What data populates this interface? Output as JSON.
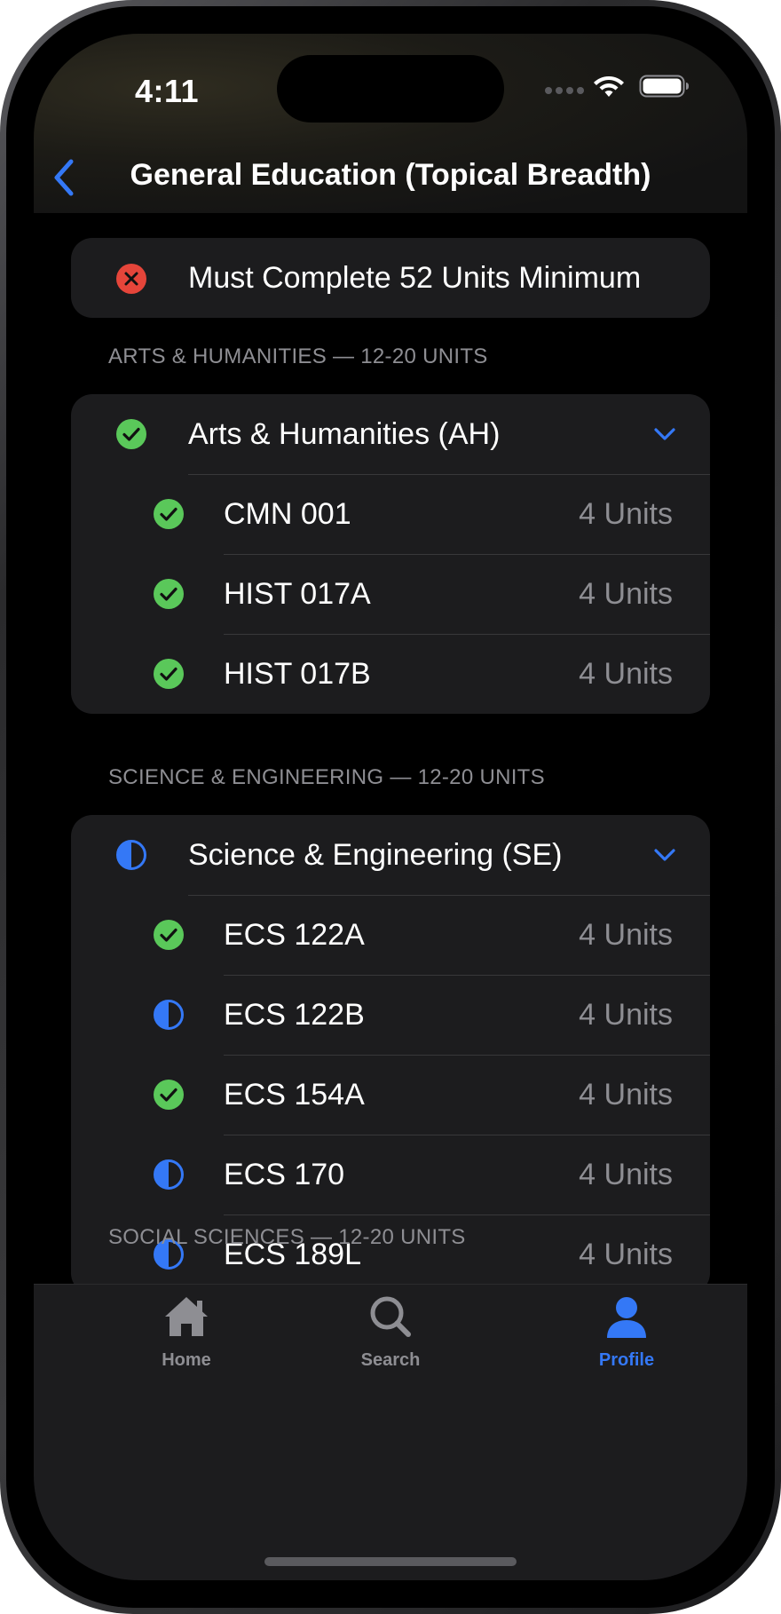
{
  "status_bar": {
    "time": "4:11"
  },
  "nav": {
    "title": "General Education (Topical Breadth)",
    "back_icon": "chevron-left-icon"
  },
  "banner": {
    "text": "Must Complete 52 Units Minimum",
    "status": "incomplete"
  },
  "colors": {
    "accent": "#3478f6",
    "success": "#5ac85a",
    "error": "#e5453a",
    "card_bg": "#1c1c1e",
    "secondary_text": "#8e8e93"
  },
  "sections": [
    {
      "header": "ARTS & HUMANITIES — 12-20 UNITS",
      "group": {
        "label": "Arts & Humanities (AH)",
        "status": "complete"
      },
      "courses": [
        {
          "code": "CMN 001",
          "units": "4 Units",
          "status": "complete"
        },
        {
          "code": "HIST 017A",
          "units": "4 Units",
          "status": "complete"
        },
        {
          "code": "HIST 017B",
          "units": "4 Units",
          "status": "complete"
        }
      ]
    },
    {
      "header": "SCIENCE & ENGINEERING — 12-20 UNITS",
      "group": {
        "label": "Science & Engineering (SE)",
        "status": "in-progress"
      },
      "courses": [
        {
          "code": "ECS 122A",
          "units": "4 Units",
          "status": "complete"
        },
        {
          "code": "ECS 122B",
          "units": "4 Units",
          "status": "in-progress"
        },
        {
          "code": "ECS 154A",
          "units": "4 Units",
          "status": "complete"
        },
        {
          "code": "ECS 170",
          "units": "4 Units",
          "status": "in-progress"
        },
        {
          "code": "ECS 189L",
          "units": "4 Units",
          "status": "in-progress"
        }
      ]
    },
    {
      "header": "SOCIAL SCIENCES — 12-20 UNITS"
    }
  ],
  "tabs": [
    {
      "label": "Home",
      "icon": "house-icon",
      "active": false
    },
    {
      "label": "Search",
      "icon": "magnifying-glass-icon",
      "active": false
    },
    {
      "label": "Profile",
      "icon": "person-icon",
      "active": true
    }
  ]
}
